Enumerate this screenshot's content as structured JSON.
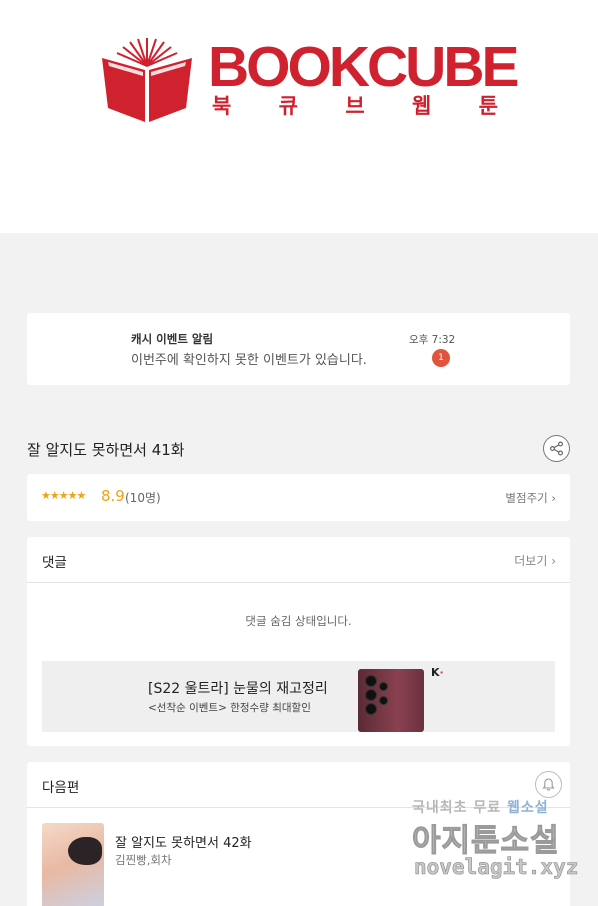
{
  "logo": {
    "wordmark": "BOOKCUBE",
    "subtitle": [
      "북",
      "큐",
      "브",
      "웹",
      "툰"
    ],
    "brand_color": "#d0212e"
  },
  "notification": {
    "title": "캐시 이벤트 알림",
    "message": "이번주에 확인하지 못한 이벤트가 있습니다.",
    "time": "오후 7:32",
    "badge": "1"
  },
  "episode": {
    "title": "잘 알지도 못하면서 41화",
    "share_icon": "share-icon"
  },
  "rating": {
    "stars": "★★★★★",
    "score": "8.9",
    "count": "(10명)",
    "rate_link": "별점주기",
    "rate_arrow": "›",
    "star_fill": 0.89
  },
  "comments": {
    "title": "댓글",
    "more": "더보기",
    "more_arrow": "›",
    "hidden_message": "댓글 숨김 상태입니다."
  },
  "ad": {
    "title": "[S22 울트라] 눈물의 재고정리",
    "subtitle": "<선착순 이벤트> 한정수량 최대할인",
    "logo": "K"
  },
  "next": {
    "title": "다음편",
    "episode_title": "잘 알지도 못하면서 42화",
    "author": "김찐빵,회차"
  },
  "watermark": {
    "line1_prefix": "국내최초 무료 ",
    "line1_highlight": "웹소설",
    "line2": "아지툰소설",
    "line3": "novelagit.xyz"
  }
}
